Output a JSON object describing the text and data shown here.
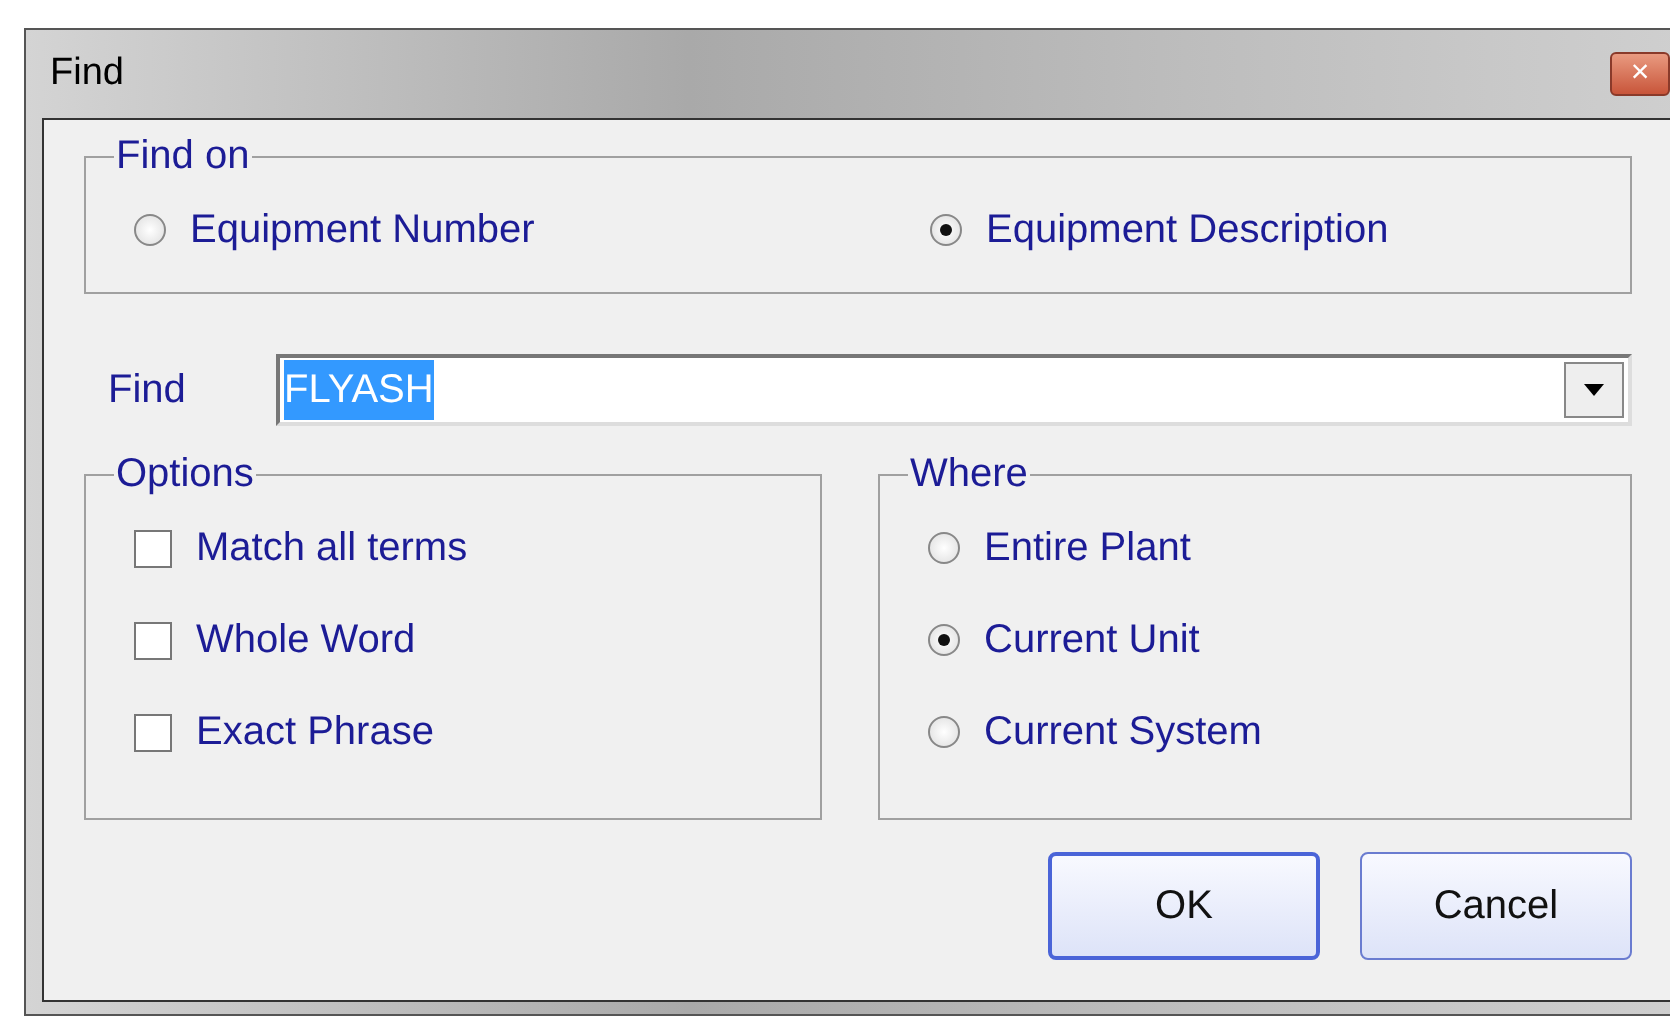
{
  "window": {
    "title": "Find",
    "close": "×"
  },
  "find_on": {
    "title": "Find on",
    "options": [
      {
        "label": "Equipment Number",
        "selected": false
      },
      {
        "label": "Equipment Description",
        "selected": true
      }
    ]
  },
  "find": {
    "label": "Find",
    "value": "FLYASH",
    "selected_text": true
  },
  "options": {
    "title": "Options",
    "items": [
      {
        "label": "Match all terms",
        "checked": false
      },
      {
        "label": "Whole Word",
        "checked": false
      },
      {
        "label": "Exact Phrase",
        "checked": false
      }
    ]
  },
  "where": {
    "title": "Where",
    "options": [
      {
        "label": "Entire Plant",
        "selected": false
      },
      {
        "label": "Current Unit",
        "selected": true
      },
      {
        "label": "Current System",
        "selected": false
      }
    ]
  },
  "buttons": [
    {
      "label": "OK",
      "default": true
    },
    {
      "label": "Cancel",
      "default": false
    }
  ]
}
